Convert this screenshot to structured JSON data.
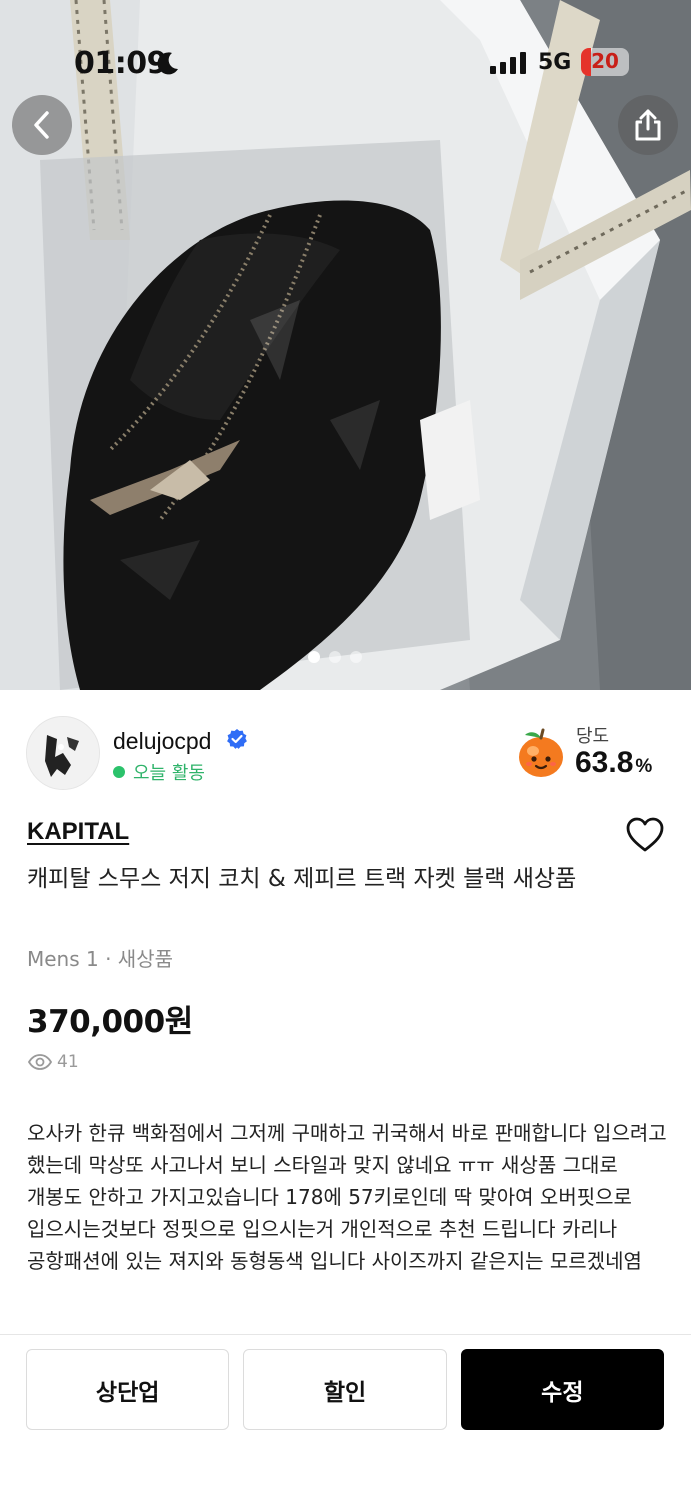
{
  "status_bar": {
    "time": "01:09",
    "network": "5G",
    "battery": "20"
  },
  "photo": {
    "page_count": 3,
    "active_index": 0
  },
  "seller": {
    "username": "delujocpd",
    "activity": "오늘 활동",
    "sweetness_label": "당도",
    "sweetness_value": "63.8",
    "sweetness_unit": "%"
  },
  "product": {
    "brand": "KAPITAL",
    "title": "캐피탈 스무스 저지 코치 & 제피르 트랙 자켓 블랙 새상품",
    "meta": "Mens 1 · 새상품",
    "price": "370,000원",
    "views": "41",
    "description": "오사카 한큐 백화점에서 그저께 구매하고 귀국해서 바로 판매합니다 입으려고 했는데 막상또 사고나서 보니 스타일과 맞지 않네요 ㅠㅠ 새상품 그대로 개봉도 안하고 가지고있습니다 178에 57키로인데 딱 맞아여 오버핏으로 입으시는것보다 정핏으로 입으시는거 개인적으로 추천 드립니다 카리나 공항패션에 있는 져지와 동형동색 입니다 사이즈까지 같은지는 모르겠네염"
  },
  "actions": {
    "bump_label": "상단업",
    "discount_label": "할인",
    "edit_label": "수정"
  },
  "colors": {
    "activity_green": "#2bc26b",
    "primary_button": "#000000",
    "verified_blue": "#2f6df6",
    "battery_red": "#e5332a"
  }
}
